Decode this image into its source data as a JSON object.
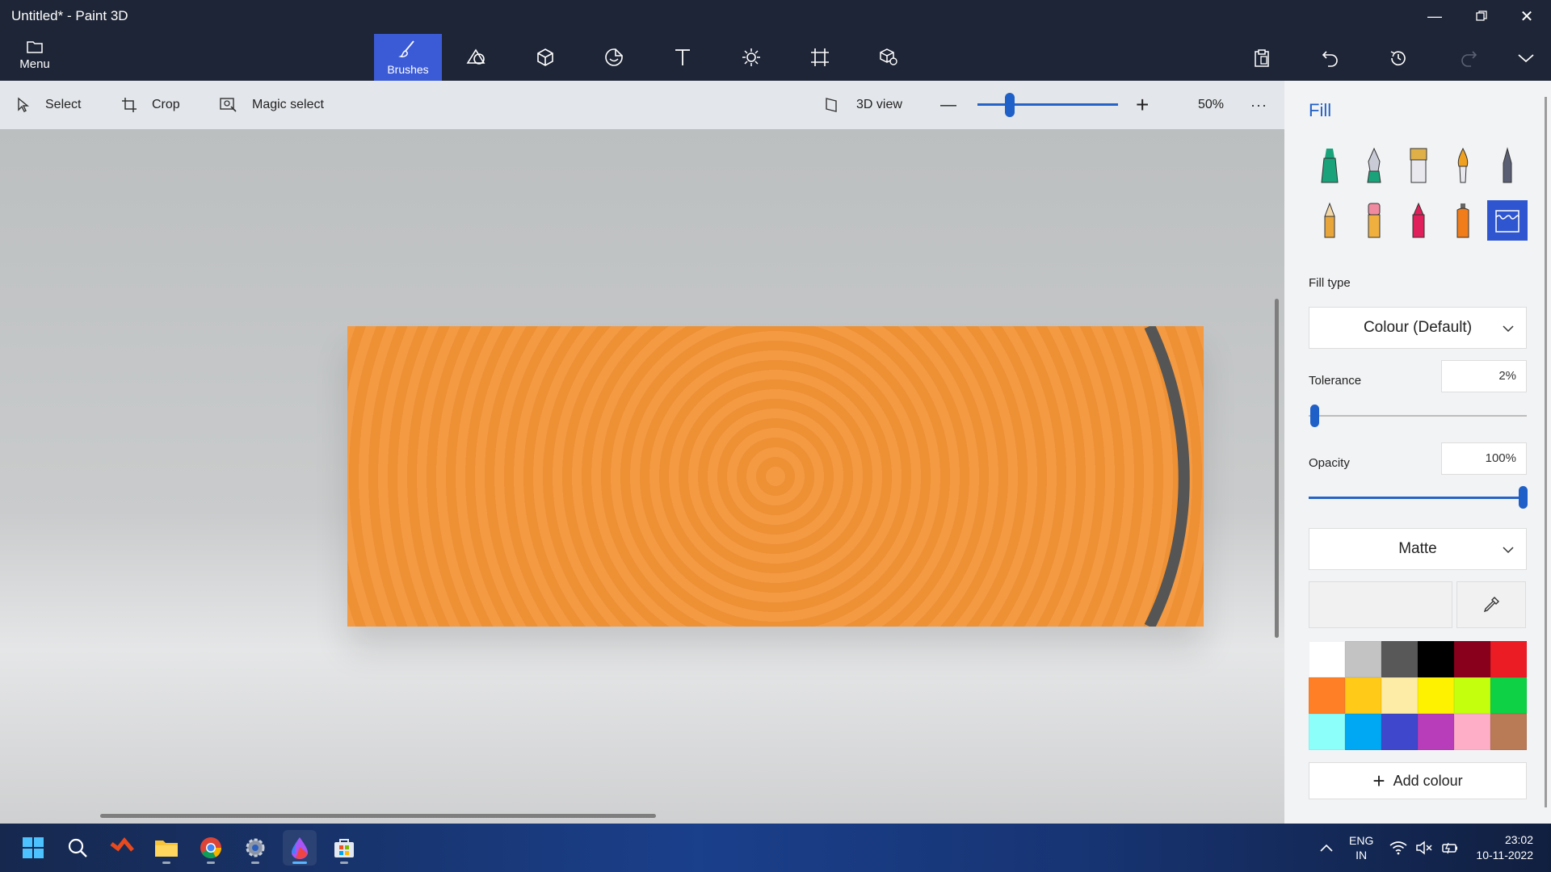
{
  "window": {
    "title": "Untitled* - Paint 3D",
    "minimize_icon": "minimize-icon",
    "restore_icon": "restore-icon",
    "close_icon": "close-icon"
  },
  "toolbar": {
    "menu_label": "Menu",
    "tools": [
      {
        "name": "brushes",
        "label": "Brushes",
        "icon": "brush-icon",
        "active": true
      },
      {
        "name": "2d-shapes",
        "label": "",
        "icon": "shapes-2d-icon"
      },
      {
        "name": "3d-shapes",
        "label": "",
        "icon": "cube-icon"
      },
      {
        "name": "stickers",
        "label": "",
        "icon": "sticker-icon"
      },
      {
        "name": "text",
        "label": "",
        "icon": "text-icon"
      },
      {
        "name": "effects",
        "label": "",
        "icon": "sun-icon"
      },
      {
        "name": "canvas",
        "label": "",
        "icon": "canvas-icon"
      },
      {
        "name": "3d-library",
        "label": "",
        "icon": "library-icon"
      }
    ],
    "right_tools": [
      "paste-icon",
      "undo-icon",
      "history-icon",
      "redo-icon",
      "expand-chevron-icon"
    ]
  },
  "subbar": {
    "select_label": "Select",
    "crop_label": "Crop",
    "magic_select_label": "Magic select",
    "view_3d_label": "3D view",
    "zoom_level": "50%",
    "zoom_minus": "—",
    "zoom_plus": "+",
    "more": "···"
  },
  "panel": {
    "title": "Fill",
    "brushes": [
      {
        "name": "marker",
        "icon": "marker-icon",
        "color": "#1aa37a"
      },
      {
        "name": "calligraphy-pen",
        "icon": "calligraphy-pen-icon",
        "color": "#6b6f82"
      },
      {
        "name": "oil-brush",
        "icon": "oil-brush-icon",
        "color": "#e0b048"
      },
      {
        "name": "watercolour",
        "icon": "watercolour-icon",
        "color": "#f0a020"
      },
      {
        "name": "pixel-pen",
        "icon": "pixel-pen-icon",
        "color": "#5a5f73"
      },
      {
        "name": "pencil",
        "icon": "pencil-icon",
        "color": "#e8a63a"
      },
      {
        "name": "eraser",
        "icon": "eraser-icon",
        "color": "#f08aa0"
      },
      {
        "name": "crayon",
        "icon": "crayon-icon",
        "color": "#e0205a"
      },
      {
        "name": "spray-can",
        "icon": "spray-can-icon",
        "color": "#f07c1a"
      },
      {
        "name": "fill",
        "icon": "fill-bucket-icon",
        "color": "#2f56d0",
        "active": true
      }
    ],
    "fill_type_label": "Fill type",
    "fill_type_value": "Colour (Default)",
    "tolerance_label": "Tolerance",
    "tolerance_value": "2%",
    "tolerance_level": 0.02,
    "opacity_label": "Opacity",
    "opacity_value": "100%",
    "opacity_level": 1.0,
    "finish_value": "Matte",
    "eyedropper_icon": "eyedropper-icon",
    "swatches": [
      "#ffffff",
      "#c3c3c3",
      "#585858",
      "#000000",
      "#88001b",
      "#ec1c24",
      "#ff7f27",
      "#ffca18",
      "#fdeca6",
      "#fff200",
      "#c4ff0e",
      "#0ed145",
      "#8cfffb",
      "#00a8f3",
      "#3f48cc",
      "#b83dba",
      "#ffaec8",
      "#b97a56"
    ],
    "add_colour_label": "Add colour",
    "add_icon": "plus-icon"
  },
  "canvas": {
    "stroke_color": "#555555",
    "fill_colors": [
      "#f39a43",
      "#ee9034"
    ]
  },
  "taskbar": {
    "apps": [
      "windows-start-icon",
      "search-icon",
      "office-icon",
      "file-explorer-icon",
      "chrome-icon",
      "settings-icon",
      "paint-3d-icon",
      "store-icon"
    ],
    "language_top": "ENG",
    "language_bottom": "IN",
    "time": "23:02",
    "date": "10-11-2022",
    "tray_icons": [
      "chevron-up-icon",
      "wifi-icon",
      "volume-muted-icon",
      "battery-icon"
    ]
  }
}
